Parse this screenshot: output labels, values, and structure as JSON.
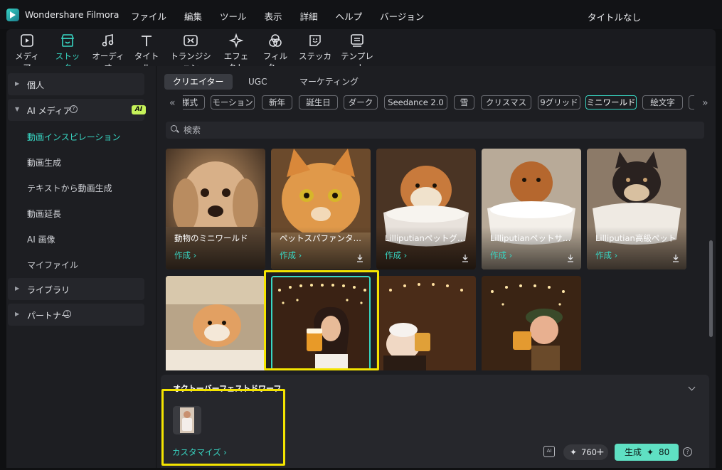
{
  "app": {
    "name": "Wondershare Filmora",
    "document_title": "タイトルなし"
  },
  "menu": [
    "ファイル",
    "編集",
    "ツール",
    "表示",
    "詳細",
    "ヘルプ",
    "バージョン"
  ],
  "toolbar": [
    {
      "label": "メディア",
      "icon": "media-icon"
    },
    {
      "label": "ストック",
      "icon": "stock-store-icon",
      "active": true
    },
    {
      "label": "オーディオ",
      "icon": "music-note-icon"
    },
    {
      "label": "タイトル",
      "icon": "text-title-icon"
    },
    {
      "label": "トランジション",
      "icon": "transition-icon"
    },
    {
      "label": "エフェクト",
      "icon": "effect-sparkle-icon"
    },
    {
      "label": "フィルター",
      "icon": "filter-icon"
    },
    {
      "label": "ステッカー",
      "icon": "sticker-icon"
    },
    {
      "label": "テンプレート",
      "icon": "template-icon"
    }
  ],
  "sidebar": {
    "groups": [
      {
        "label": "個人"
      },
      {
        "label": "AI メディア",
        "badge": "AI",
        "help": "?"
      },
      {
        "label": "ライブラリ"
      },
      {
        "label": "パートナー",
        "help": "?"
      }
    ],
    "ai_items": [
      "動画インスピレーション",
      "動画生成",
      "テキストから動画生成",
      "動画延長",
      "AI 画像",
      "マイファイル"
    ]
  },
  "tabs": [
    "クリエイター",
    "UGC",
    "マーケティング"
  ],
  "tags": [
    "様式",
    "モーション",
    "新年",
    "誕生日",
    "ダーク",
    "Seedance 2.0",
    "雪",
    "クリスマス",
    "9グリッド",
    "ミニワールド",
    "絵文字",
    "|"
  ],
  "search": {
    "placeholder": "検索"
  },
  "cards_row1": [
    {
      "title": "動物のミニワールド",
      "action": "作成 ›"
    },
    {
      "title": "ペットスパファンタジー",
      "action": "作成 ›"
    },
    {
      "title": "Lilliputianペットグルーミング",
      "action": "作成 ›"
    },
    {
      "title": "Lilliputianペットサービス",
      "action": "作成 ›"
    },
    {
      "title": "Lilliputian高級ペット",
      "action": "作成 ›"
    }
  ],
  "detail": {
    "title": "オクトーバーフェストドワーフ",
    "customize": "カスタマイズ ›",
    "credits": "760",
    "ai_icon": "AI",
    "generate_label": "生成",
    "generate_cost": "80",
    "help": "?"
  },
  "colors": {
    "accent": "#38d6c3",
    "highlight": "#f4e400",
    "generate": "#5fe0c3"
  }
}
